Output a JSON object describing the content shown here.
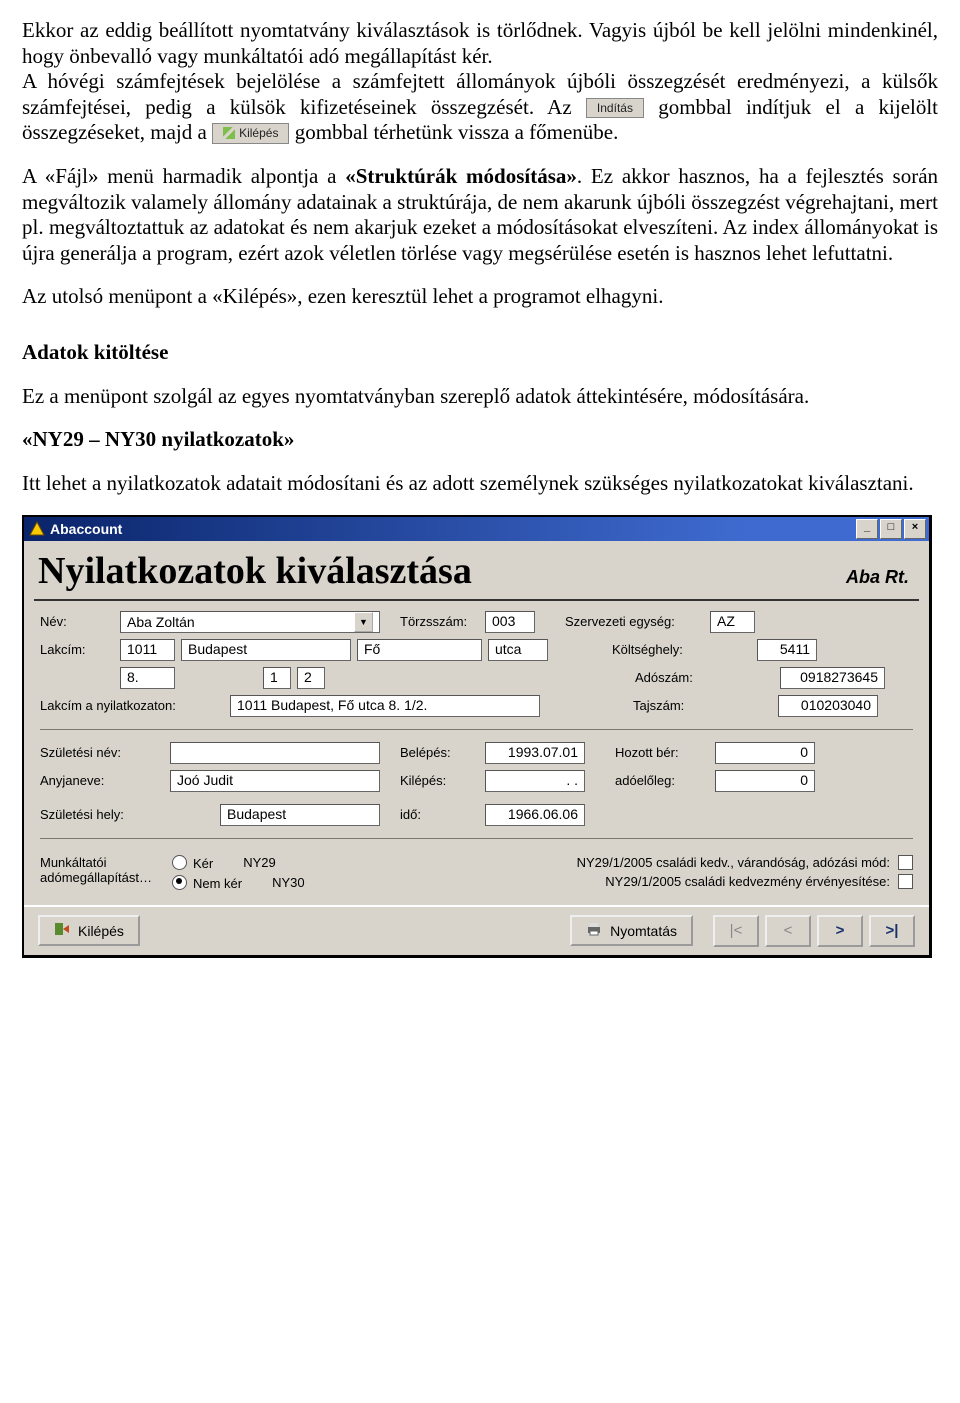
{
  "doc": {
    "p1_a": "Ekkor az eddig beállított nyomtatvány kiválasztások is törlődnek. Vagyis újból be kell jelölni mindenkinél, hogy önbevalló vagy munkáltatói adó megállapítást kér.",
    "p1_b": "A hóvégi számfejtések bejelölése a számfejtett állományok újbóli összegzését eredményezi, a külsők számfejtései, pedig a külsök kifizetéseinek összegzését. Az ",
    "btn_inditas": "Indítás",
    "p1_c": " gombbal indítjuk el a kijelölt összegzéseket, majd a ",
    "btn_kilepes_inline": "Kilépés",
    "p1_d": " gombbal térhetünk vissza a főmenübe.",
    "p2_a": "A «Fájl» menü harmadik alpontja a ",
    "p2_b": "«Struktúrák módosítása»",
    "p2_c": ". Ez akkor hasznos, ha a fejlesztés során megváltozik valamely állomány adatainak a struktúrája, de nem akarunk újbóli összegzést végrehajtani, mert pl. megváltoztattuk az adatokat és nem akarjuk ezeket a módosításokat elveszíteni. Az index állományokat is újra generálja a program, ezért azok véletlen törlése vagy megsérülése esetén is hasznos lehet lefuttatni.",
    "p3": "Az utolsó menüpont a «Kilépés», ezen keresztül lehet a programot elhagyni.",
    "h_adatok": "Adatok kitöltése",
    "p4": "Ez a menüpont szolgál az egyes nyomtatványban szereplő adatok áttekintésére, módosítására.",
    "h_ny": "«NY29 – NY30 nyilatkozatok»",
    "p5": "Itt lehet a nyilatkozatok adatait módosítani és az adott személynek szükséges nyilatkozatokat kiválasztani."
  },
  "win": {
    "title": "Abaccount",
    "heading": "Nyilatkozatok kiválasztása",
    "company": "Aba Rt.",
    "labels": {
      "nev": "Név:",
      "torzsszam": "Törzsszám:",
      "szerv": "Szervezeti egység:",
      "lakcim": "Lakcím:",
      "koltseghely": "Költséghely:",
      "adoszam": "Adószám:",
      "lakcim_ny": "Lakcím a nyilatkozaton:",
      "tajszam": "Tajszám:",
      "szulnev": "Születési név:",
      "belepes": "Belépés:",
      "hozott": "Hozott bér:",
      "anyaneve": "Anyjaneve:",
      "kilepes": "Kilépés:",
      "adoeloleg": "adóelőleg:",
      "szulhely": "Születési hely:",
      "ido": "idő:",
      "munk": "Munkáltatói adómegállapítást…",
      "ker": "Kér",
      "nemker": "Nem kér",
      "ny29": "NY29",
      "ny30": "NY30",
      "chk1": "NY29/1/2005 családi kedv., várandóság, adózási mód:",
      "chk2": "NY29/1/2005 családi kedvezmény érvényesítése:"
    },
    "values": {
      "nev": "Aba Zoltán",
      "torzsszam": "003",
      "szerv": "AZ",
      "irsz": "1011",
      "varos": "Budapest",
      "utcanev": "Fő",
      "kozterulet": "utca",
      "hazszam": "8.",
      "emelet": "1",
      "ajto": "2",
      "koltseghely": "5411",
      "adoszam": "0918273645",
      "lakcim_ny": "1011 Budapest, Fő utca 8. 1/2.",
      "tajszam": "010203040",
      "szulnev": "",
      "belepes": "1993.07.01",
      "hozott": "0",
      "anyaneve": "Joó Judit",
      "kilepes": ".  .",
      "adoeloleg": "0",
      "szulhely": "Budapest",
      "ido": "1966.06.06"
    },
    "buttons": {
      "kilepes": "Kilépés",
      "nyomtatas": "Nyomtatás",
      "min": "_",
      "max": "□",
      "close": "×",
      "first": "|<",
      "prev": "<",
      "next": ">",
      "last": ">|"
    }
  }
}
